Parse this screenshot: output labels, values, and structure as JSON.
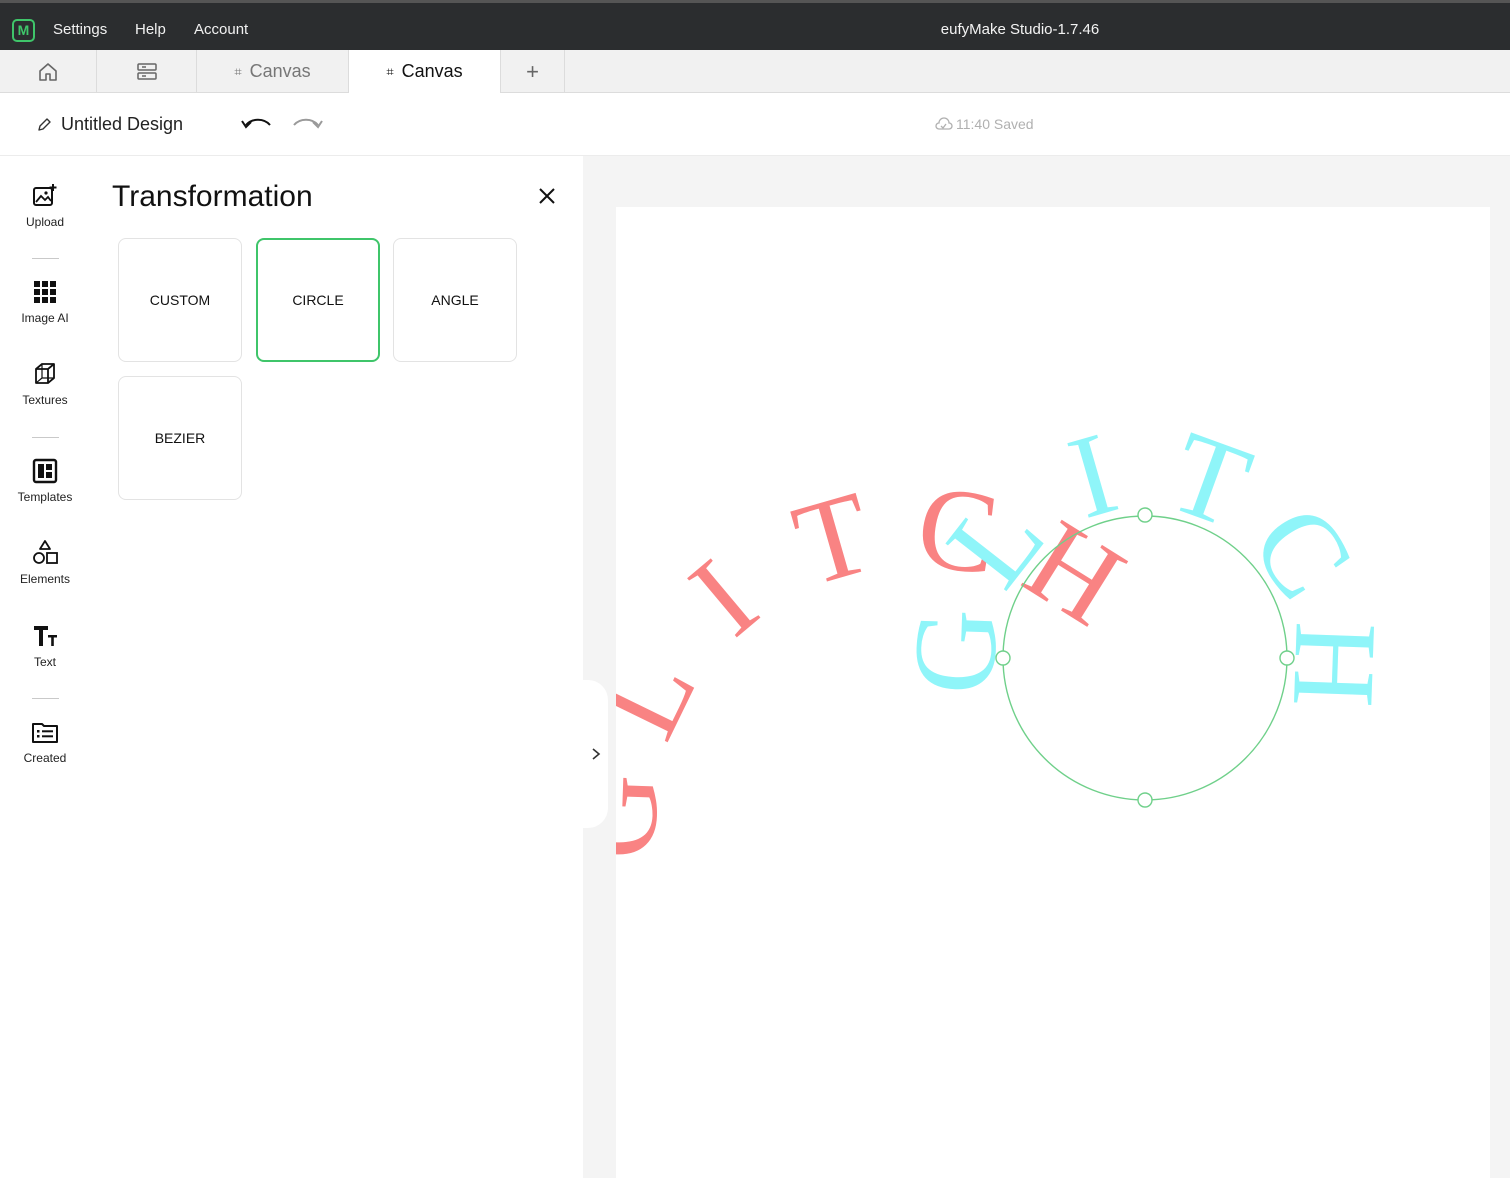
{
  "app": {
    "logo_letter": "M",
    "title": "eufyMake Studio-1.7.46",
    "menu": [
      "Settings",
      "Help",
      "Account"
    ]
  },
  "tabs": [
    {
      "label": "",
      "icon": "home-icon"
    },
    {
      "label": "",
      "icon": "layers-icon"
    },
    {
      "label": "Canvas",
      "icon": "canvas-icon"
    },
    {
      "label": "Canvas",
      "icon": "canvas-icon",
      "active": true
    },
    {
      "label": "+",
      "icon": "plus-icon"
    }
  ],
  "toolbar": {
    "design_name": "Untitled Design",
    "save_status": "11:40 Saved"
  },
  "rail": [
    {
      "label": "Upload",
      "icon": "upload-image-icon"
    },
    {
      "label": "Image AI",
      "icon": "grid-icon"
    },
    {
      "label": "Textures",
      "icon": "cube-icon"
    },
    {
      "label": "Templates",
      "icon": "templates-icon"
    },
    {
      "label": "Elements",
      "icon": "shapes-icon"
    },
    {
      "label": "Text",
      "icon": "text-icon"
    },
    {
      "label": "Created",
      "icon": "folder-list-icon"
    }
  ],
  "panel": {
    "title": "Transformation",
    "options": [
      "CUSTOM",
      "CIRCLE",
      "ANGLE",
      "BEZIER"
    ],
    "selected": "CIRCLE"
  },
  "canvas": {
    "red_text": "GLITCH",
    "cyan_text": "GLITCH",
    "colors": {
      "red": "#f98383",
      "cyan": "#8ff5f9",
      "accent": "#3fc56a"
    }
  }
}
